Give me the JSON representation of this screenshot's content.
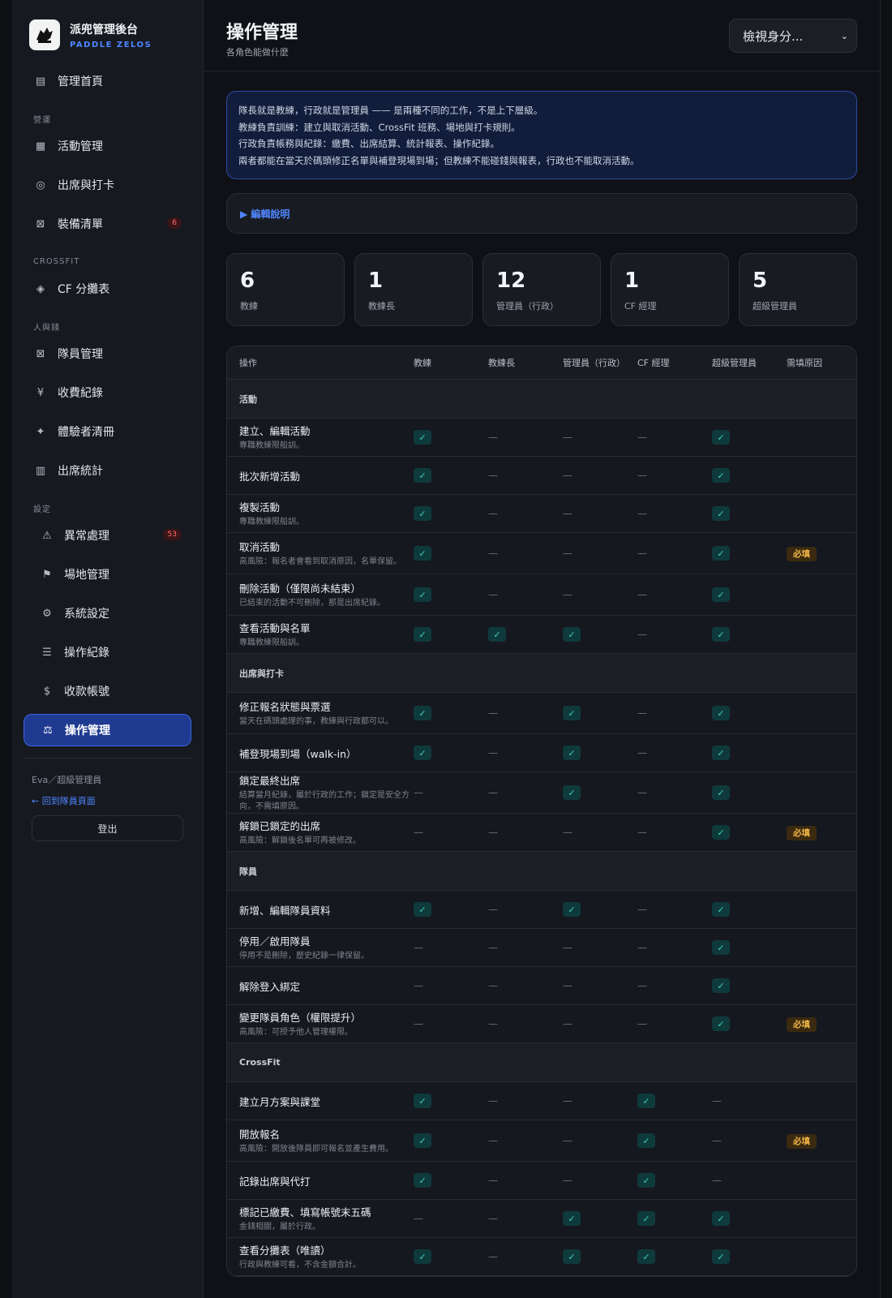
{
  "brand": {
    "title": "派兜管理後台",
    "subtitle": "PADDLE ZELOS"
  },
  "nav": {
    "home": {
      "label": "管理首頁",
      "icon": "list-icon"
    },
    "group_ops": "營運",
    "activities": {
      "label": "活動管理",
      "icon": "grid-icon"
    },
    "attendance": {
      "label": "出席與打卡",
      "icon": "circle-target-icon"
    },
    "equipment": {
      "label": "裝備清單",
      "icon": "box-icon",
      "badge": "6"
    },
    "group_crossfit": "CROSSFIT",
    "cf_rank": {
      "label": "CF 分攤表",
      "icon": "diamond-icon"
    },
    "group_people": "人與錢",
    "members": {
      "label": "隊員管理",
      "icon": "box-icon"
    },
    "payments": {
      "label": "收費紀錄",
      "icon": "yen-icon"
    },
    "trials": {
      "label": "體驗者清冊",
      "icon": "sparkle-icon"
    },
    "stats": {
      "label": "出席統計",
      "icon": "bars-icon"
    },
    "group_settings": "設定",
    "exceptions": {
      "label": "異常處理",
      "icon": "warning-icon",
      "badge": "53"
    },
    "venues": {
      "label": "場地管理",
      "icon": "flag-icon"
    },
    "system": {
      "label": "系統設定",
      "icon": "gear-icon"
    },
    "logs": {
      "label": "操作紀錄",
      "icon": "menu-icon"
    },
    "accounts": {
      "label": "收款帳號",
      "icon": "dollar-icon"
    },
    "permissions": {
      "label": "操作管理",
      "icon": "scale-icon"
    }
  },
  "user": {
    "name": "Eva／超級管理員",
    "back": "← 回到隊員頁面",
    "logout": "登出"
  },
  "header": {
    "title": "操作管理",
    "subtitle": "各角色能做什麼",
    "select": "檢視身分..."
  },
  "info": {
    "line1": "隊長就是教練，行政就是管理員 —— 是兩種不同的工作，不是上下層級。",
    "line2": "教練負責訓練：建立與取消活動、CrossFit 班務、場地與打卡規則。",
    "line3": "行政負責帳務與紀錄：繳費、出席結算、統計報表、操作紀錄。",
    "line4": "兩者都能在當天於碼頭修正名單與補登現場到場；但教練不能碰錢與報表，行政也不能取消活動。"
  },
  "explain": "▶ 編輯說明",
  "stats": [
    {
      "value": "6",
      "label": "教練"
    },
    {
      "value": "1",
      "label": "教練長"
    },
    {
      "value": "12",
      "label": "管理員（行政）"
    },
    {
      "value": "1",
      "label": "CF 經理"
    },
    {
      "value": "5",
      "label": "超級管理員"
    }
  ],
  "table": {
    "headers": [
      "操作",
      "教練",
      "教練長",
      "管理員（行政）",
      "CF 經理",
      "超級管理員",
      "需填原因"
    ],
    "sec_activity": "活動",
    "sec_attendance": "出席與打卡",
    "sec_members": "隊員",
    "sec_crossfit": "CrossFit",
    "rows": [
      {
        "name": "建立、編輯活動",
        "note": "專職教練限船訓。",
        "perm": [
          "✓",
          "—",
          "—",
          "—",
          "✓"
        ],
        "req": ""
      },
      {
        "name": "批次新增活動",
        "note": "",
        "perm": [
          "✓",
          "—",
          "—",
          "—",
          "✓"
        ],
        "req": ""
      },
      {
        "name": "複製活動",
        "note": "專職教練限船訓。",
        "perm": [
          "✓",
          "—",
          "—",
          "—",
          "✓"
        ],
        "req": ""
      },
      {
        "name": "取消活動",
        "note": "高風險：報名者會看到取消原因，名單保留。",
        "perm": [
          "✓",
          "—",
          "—",
          "—",
          "✓"
        ],
        "req": "必填"
      },
      {
        "name": "刪除活動（僅限尚未結束）",
        "note": "已結束的活動不可刪除，那是出席紀錄。",
        "perm": [
          "✓",
          "—",
          "—",
          "—",
          "✓"
        ],
        "req": ""
      },
      {
        "name": "查看活動與名單",
        "note": "專職教練限船訓。",
        "perm": [
          "✓",
          "✓",
          "✓",
          "—",
          "✓"
        ],
        "req": ""
      },
      {
        "name": "修正報名狀態與票選",
        "note": "當天在碼頭處理的事，教練與行政都可以。",
        "perm": [
          "✓",
          "—",
          "✓",
          "—",
          "✓"
        ],
        "req": ""
      },
      {
        "name": "補登現場到場（walk-in）",
        "note": "",
        "perm": [
          "✓",
          "—",
          "✓",
          "—",
          "✓"
        ],
        "req": ""
      },
      {
        "name": "鎖定最終出席",
        "note": "結算當月紀錄，屬於行政的工作；鎖定是安全方向，不需填原因。",
        "perm": [
          "—",
          "—",
          "✓",
          "—",
          "✓"
        ],
        "req": ""
      },
      {
        "name": "解鎖已鎖定的出席",
        "note": "高風險：解鎖後名單可再被修改。",
        "perm": [
          "—",
          "—",
          "—",
          "—",
          "✓"
        ],
        "req": "必填"
      },
      {
        "name": "新增、編輯隊員資料",
        "note": "",
        "perm": [
          "✓",
          "—",
          "✓",
          "—",
          "✓"
        ],
        "req": ""
      },
      {
        "name": "停用／啟用隊員",
        "note": "停用不是刪除，歷史紀錄一律保留。",
        "perm": [
          "—",
          "—",
          "—",
          "—",
          "✓"
        ],
        "req": ""
      },
      {
        "name": "解除登入綁定",
        "note": "",
        "perm": [
          "—",
          "—",
          "—",
          "—",
          "✓"
        ],
        "req": ""
      },
      {
        "name": "變更隊員角色（權限提升）",
        "note": "高風險：可授予他人管理權限。",
        "perm": [
          "—",
          "—",
          "—",
          "—",
          "✓"
        ],
        "req": "必填"
      },
      {
        "name": "建立月方案與課堂",
        "note": "",
        "perm": [
          "✓",
          "—",
          "—",
          "✓",
          "—"
        ],
        "req": ""
      },
      {
        "name": "開放報名",
        "note": "高風險：開放後隊員即可報名並產生費用。",
        "perm": [
          "✓",
          "—",
          "—",
          "✓",
          "—"
        ],
        "req": "必填"
      },
      {
        "name": "記錄出席與代打",
        "note": "",
        "perm": [
          "✓",
          "—",
          "—",
          "✓",
          "—"
        ],
        "req": ""
      },
      {
        "name": "標記已繳費、填寫帳號末五碼",
        "note": "金錢相關，屬於行政。",
        "perm": [
          "—",
          "—",
          "✓",
          "✓",
          "✓"
        ],
        "req": ""
      },
      {
        "name": "查看分攤表（唯讀）",
        "note": "行政與教練可看，不含金額合計。",
        "perm": [
          "✓",
          "—",
          "✓",
          "✓",
          "✓"
        ],
        "req": ""
      }
    ]
  }
}
